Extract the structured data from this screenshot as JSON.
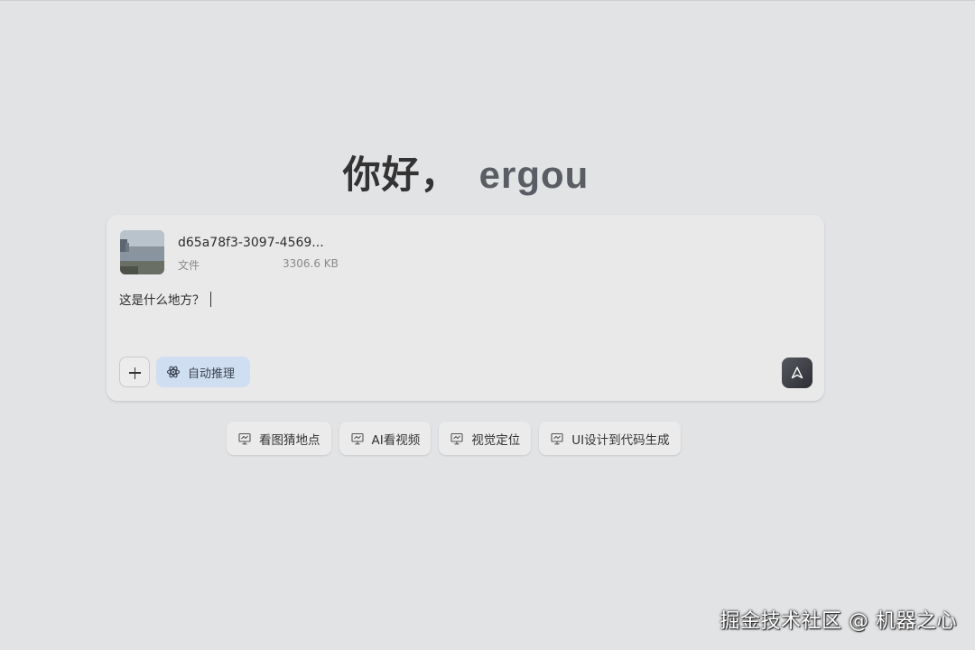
{
  "greeting": {
    "hello": "你好，",
    "name": "ergou"
  },
  "composer": {
    "attachment": {
      "file_name": "d65a78f3-3097-4569...",
      "file_type": "文件",
      "file_size": "3306.6 KB",
      "thumbnail_icon": "image-thumbnail"
    },
    "prompt_text": "这是什么地方？",
    "add_icon": "plus-icon",
    "reason_button": {
      "label": "自动推理",
      "icon": "atom-icon"
    },
    "send_icon": "send-icon"
  },
  "suggestions": [
    {
      "label": "看图猜地点",
      "icon": "presentation-icon"
    },
    {
      "label": "AI看视频",
      "icon": "presentation-icon"
    },
    {
      "label": "视觉定位",
      "icon": "presentation-icon"
    },
    {
      "label": "UI设计到代码生成",
      "icon": "presentation-icon"
    }
  ],
  "watermark": "掘金技术社区 @ 机器之心",
  "colors": {
    "background": "#e2e3e5",
    "composer_bg": "#e9e9ea",
    "reason_button_bg": "#cfdef0",
    "send_button_bg": "#3a3c41"
  }
}
